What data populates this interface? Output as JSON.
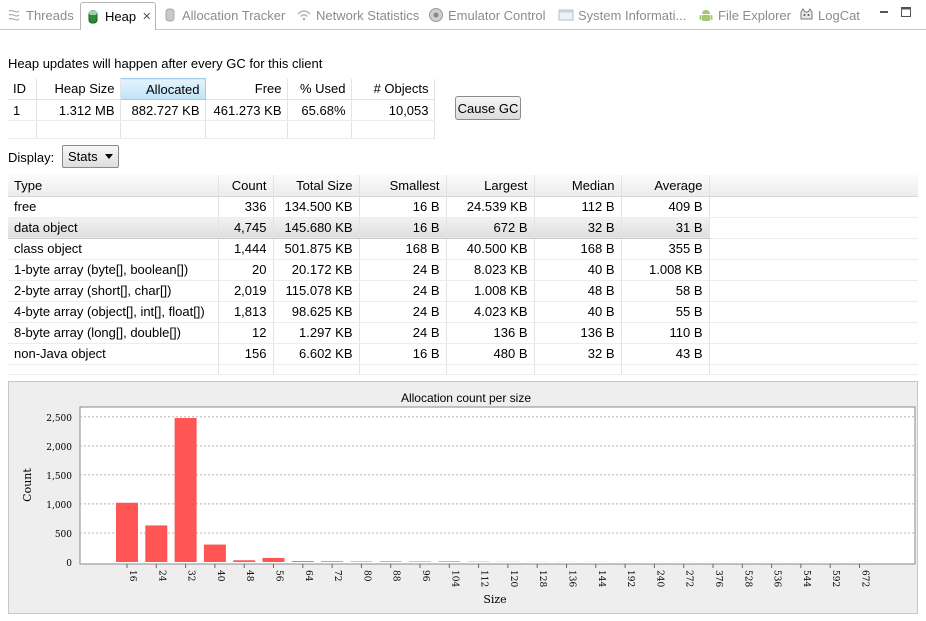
{
  "tabs": [
    {
      "label": "Threads",
      "icon": "threads-icon",
      "active": false
    },
    {
      "label": "Heap",
      "icon": "heap-icon",
      "active": true
    },
    {
      "label": "Allocation Tracker",
      "icon": "allocation-tracker-icon",
      "active": false
    },
    {
      "label": "Network Statistics",
      "icon": "network-icon",
      "active": false
    },
    {
      "label": "Emulator Control",
      "icon": "emulator-icon",
      "active": false
    },
    {
      "label": "System Informati...",
      "icon": "system-info-icon",
      "active": false
    },
    {
      "label": "File Explorer",
      "icon": "android-icon",
      "active": false
    },
    {
      "label": "LogCat",
      "icon": "logcat-icon",
      "active": false
    }
  ],
  "heap": {
    "notice": "Heap updates will happen after every GC for this client",
    "columns": [
      "ID",
      "Heap Size",
      "Allocated",
      "Free",
      "% Used",
      "# Objects"
    ],
    "row": [
      "1",
      "1.312 MB",
      "882.727 KB",
      "461.273 KB",
      "65.68%",
      "10,053"
    ],
    "cause_gc": "Cause GC",
    "display_label": "Display:",
    "display_value": "Stats"
  },
  "stats": {
    "columns": [
      "Type",
      "Count",
      "Total Size",
      "Smallest",
      "Largest",
      "Median",
      "Average"
    ],
    "rows": [
      [
        "free",
        "336",
        "134.500 KB",
        "16 B",
        "24.539 KB",
        "112 B",
        "409 B"
      ],
      [
        "data object",
        "4,745",
        "145.680 KB",
        "16 B",
        "672 B",
        "32 B",
        "31 B"
      ],
      [
        "class object",
        "1,444",
        "501.875 KB",
        "168 B",
        "40.500 KB",
        "168 B",
        "355 B"
      ],
      [
        "1-byte array (byte[], boolean[])",
        "20",
        "20.172 KB",
        "24 B",
        "8.023 KB",
        "40 B",
        "1.008 KB"
      ],
      [
        "2-byte array (short[], char[])",
        "2,019",
        "115.078 KB",
        "24 B",
        "1.008 KB",
        "48 B",
        "58 B"
      ],
      [
        "4-byte array (object[], int[], float[])",
        "1,813",
        "98.625 KB",
        "24 B",
        "4.023 KB",
        "40 B",
        "55 B"
      ],
      [
        "8-byte array (long[], double[])",
        "12",
        "1.297 KB",
        "24 B",
        "136 B",
        "136 B",
        "110 B"
      ],
      [
        "non-Java object",
        "156",
        "6.602 KB",
        "16 B",
        "480 B",
        "32 B",
        "43 B"
      ]
    ]
  },
  "chart_data": {
    "type": "bar",
    "title": "Allocation count per size",
    "xlabel": "Size",
    "ylabel": "Count",
    "ylim": [
      0,
      2600
    ],
    "yticks": [
      "0",
      "500",
      "1,000",
      "1,500",
      "2,000",
      "2,500"
    ],
    "ytick_values": [
      0,
      500,
      1000,
      1500,
      2000,
      2500
    ],
    "categories": [
      "16",
      "24",
      "32",
      "40",
      "48",
      "56",
      "64",
      "72",
      "80",
      "88",
      "96",
      "104",
      "112",
      "120",
      "128",
      "136",
      "144",
      "192",
      "240",
      "272",
      "376",
      "528",
      "536",
      "544",
      "592",
      "672"
    ],
    "values": [
      1020,
      630,
      2480,
      300,
      30,
      70,
      15,
      12,
      8,
      10,
      8,
      10,
      5,
      3,
      2,
      2,
      2,
      1,
      1,
      1,
      1,
      1,
      1,
      1,
      1,
      1
    ],
    "color": "#ff5555"
  }
}
